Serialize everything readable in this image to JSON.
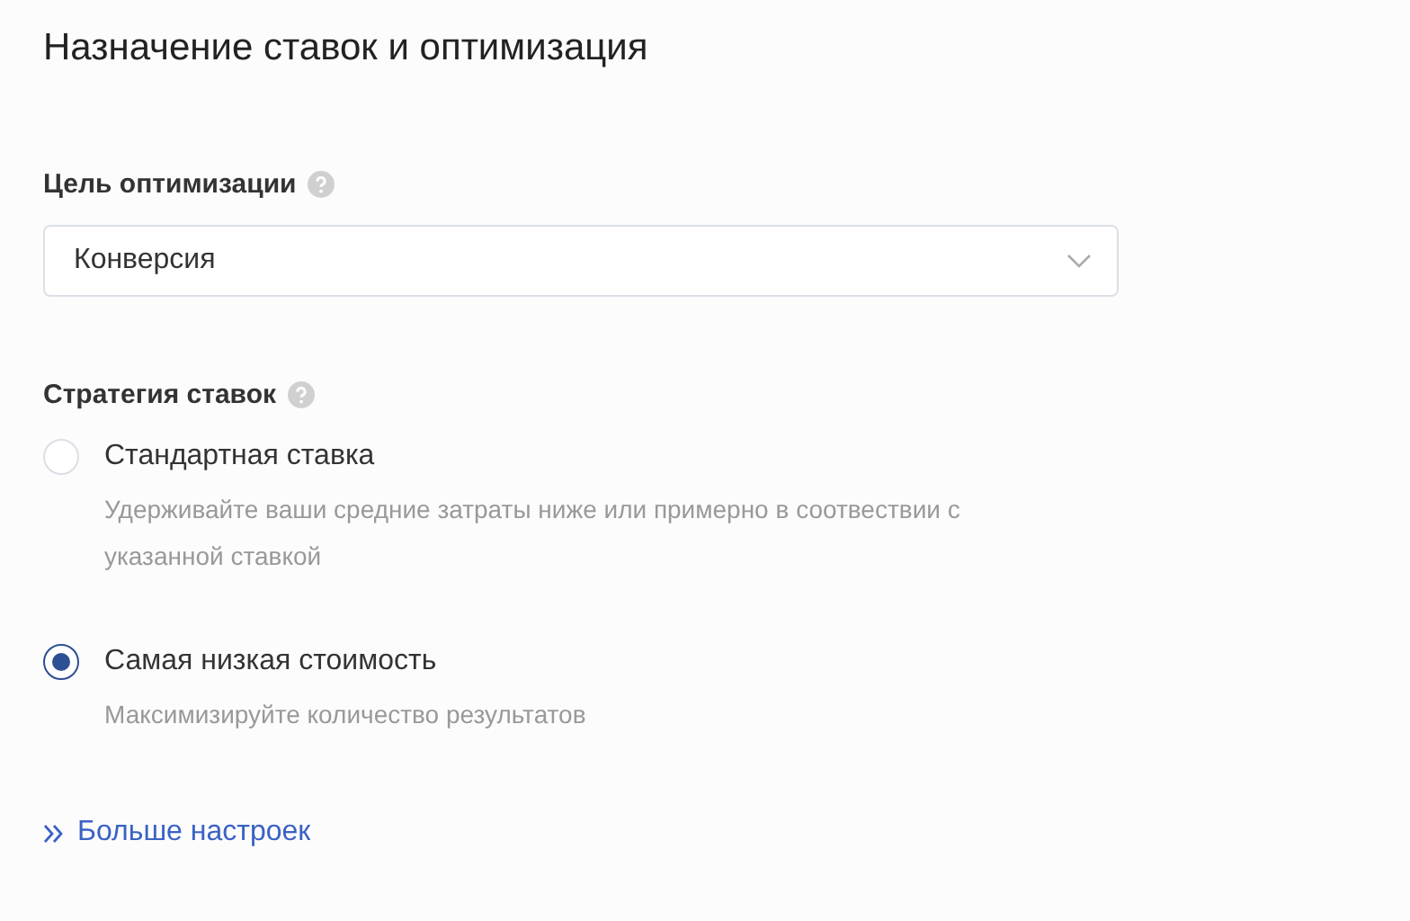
{
  "title": "Назначение ставок и оптимизация",
  "optimization_goal": {
    "label": "Цель оптимизации",
    "value": "Конверсия"
  },
  "bid_strategy": {
    "label": "Стратегия ставок",
    "options": [
      {
        "label": "Стандартная ставка",
        "description": "Удерживайте ваши средние затраты ниже или примерно в соотвествии с указанной ставкой",
        "selected": false
      },
      {
        "label": "Самая низкая стоимость",
        "description": "Максимизируйте количество результатов",
        "selected": true
      }
    ]
  },
  "more_link": {
    "label": "Больше настроек"
  }
}
